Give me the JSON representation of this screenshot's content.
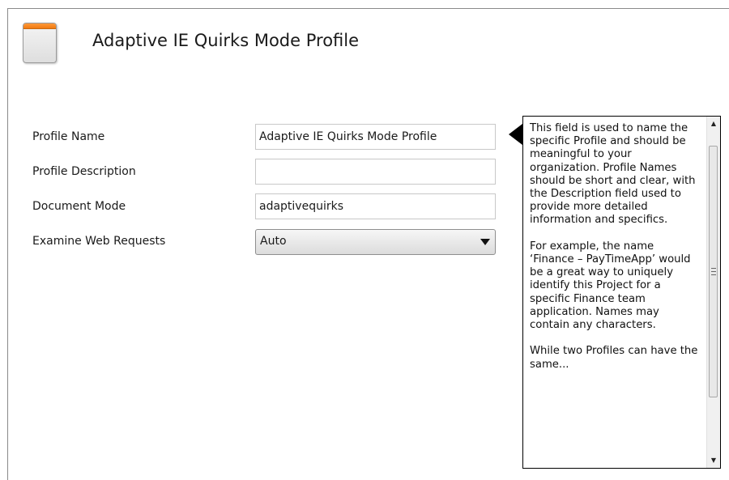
{
  "header": {
    "title": "Adaptive IE Quirks Mode Profile",
    "icon": "profile-window-icon"
  },
  "form": {
    "fields": [
      {
        "label": "Profile Name",
        "value": "Adaptive IE Quirks Mode Profile",
        "placeholder": ""
      },
      {
        "label": "Profile Description",
        "value": "",
        "placeholder": ""
      },
      {
        "label": "Document Mode",
        "value": "adaptivequirks",
        "placeholder": ""
      },
      {
        "label": "Examine Web Requests",
        "selected": "Auto"
      }
    ]
  },
  "help": {
    "text": "This field is used to name the specific Profile and should be meaningful to your organization. Profile Names should be short and clear, with the Description field used to provide more detailed information and specifics.\n\nFor example, the name ‘Finance – PayTimeApp’ would be a great way to uniquely identify this Project for a specific Finance team application. Names may contain any characters.\n\nWhile two Profiles can have the same..."
  },
  "scrollbar": {
    "up_icon": "▲",
    "down_icon": "▼"
  },
  "colors": {
    "icon_accent": "#f07a10",
    "tooltip_border": "#000000"
  }
}
